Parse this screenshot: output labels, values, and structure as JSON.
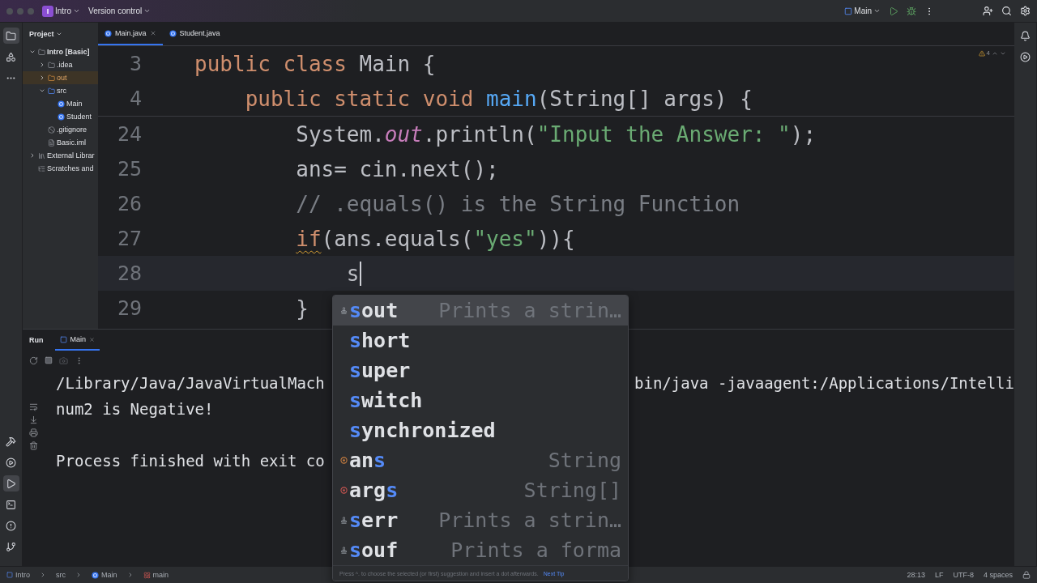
{
  "title_bar": {
    "project_badge": "I",
    "project": "Intro",
    "vcs": "Version control",
    "run_config": "Main"
  },
  "tool_windows": [
    {
      "kind": "project",
      "selected": true
    },
    {
      "kind": "structure",
      "selected": false
    },
    {
      "kind": "more",
      "selected": false
    }
  ],
  "bottom_tools": [
    {
      "kind": "build",
      "selected": false
    },
    {
      "kind": "services",
      "selected": false
    },
    {
      "kind": "run",
      "selected": true
    },
    {
      "kind": "terminal",
      "selected": false
    },
    {
      "kind": "problems",
      "selected": false
    },
    {
      "kind": "git",
      "selected": false
    }
  ],
  "project_panel": {
    "title": "Project",
    "tree": [
      {
        "label": "Intro [Basic]",
        "kind": "module",
        "expanded": true,
        "selected": false,
        "children": [
          {
            "label": ".idea",
            "kind": "folder",
            "expanded": false,
            "selected": false
          },
          {
            "label": "out",
            "kind": "excluded",
            "expanded": false,
            "selected": true
          },
          {
            "label": "src",
            "kind": "source",
            "expanded": true,
            "selected": false,
            "children": [
              {
                "label": "Main",
                "kind": "class",
                "selected": false
              },
              {
                "label": "Student",
                "kind": "class",
                "selected": false
              }
            ]
          },
          {
            "label": ".gitignore",
            "kind": "ignore",
            "selected": false
          },
          {
            "label": "Basic.iml",
            "kind": "iml",
            "selected": false
          }
        ]
      },
      {
        "label": "External Librar",
        "kind": "libraries",
        "expanded": false,
        "selected": false
      },
      {
        "label": "Scratches and",
        "kind": "scratches",
        "selected": false
      }
    ]
  },
  "editor": {
    "tabs": [
      {
        "label": "Main.java",
        "selected": true
      },
      {
        "label": "Student.java",
        "selected": false
      }
    ],
    "warning_count": "4",
    "sticky_lines": [
      {
        "number": "3",
        "tokens": [
          {
            "kind": "keyword",
            "text": "public class "
          },
          {
            "kind": "plain",
            "text": "Main {"
          }
        ]
      },
      {
        "number": "4",
        "tokens": [
          {
            "kind": "keyword",
            "text": "    public static void "
          },
          {
            "kind": "method",
            "text": "main"
          },
          {
            "kind": "plain",
            "text": "(String[] args) {"
          }
        ]
      }
    ],
    "lines": [
      {
        "number": "24",
        "current": false,
        "tokens": [
          {
            "kind": "plain",
            "text": "        System."
          },
          {
            "kind": "field",
            "text": "out"
          },
          {
            "kind": "plain",
            "text": ".println("
          },
          {
            "kind": "string",
            "text": "\"Input the Answer: \""
          },
          {
            "kind": "plain",
            "text": ");"
          }
        ]
      },
      {
        "number": "25",
        "current": false,
        "tokens": [
          {
            "kind": "plain",
            "text": "        ans= cin.next();"
          }
        ]
      },
      {
        "number": "26",
        "current": false,
        "tokens": [
          {
            "kind": "comment",
            "text": "        // .equals() is the String Function"
          }
        ]
      },
      {
        "number": "27",
        "current": false,
        "tokens": [
          {
            "kind": "warned_keyword",
            "text": "        if"
          },
          {
            "kind": "plain",
            "text": "(ans.equals("
          },
          {
            "kind": "string",
            "text": "\"yes\""
          },
          {
            "kind": "plain",
            "text": ")){"
          }
        ]
      },
      {
        "number": "28",
        "current": true,
        "tokens": [
          {
            "kind": "plain",
            "text": "            s"
          }
        ]
      },
      {
        "number": "29",
        "current": false,
        "tokens": [
          {
            "kind": "plain",
            "text": "        }"
          }
        ]
      }
    ]
  },
  "completion": {
    "items": [
      {
        "kind": "template",
        "match": "s",
        "tail": "out",
        "detail": "Prints a strin…",
        "selected": true
      },
      {
        "kind": "keyword",
        "match": "s",
        "tail": "hort",
        "selected": false
      },
      {
        "kind": "keyword",
        "match": "s",
        "tail": "uper",
        "selected": false
      },
      {
        "kind": "keyword",
        "match": "s",
        "tail": "witch",
        "selected": false
      },
      {
        "kind": "keyword",
        "match": "s",
        "tail": "ynchronized",
        "selected": false
      },
      {
        "kind": "variable",
        "head": "an",
        "match": "s",
        "type": "String",
        "selected": false
      },
      {
        "kind": "parameter",
        "head": "arg",
        "match": "s",
        "type": "String[]",
        "selected": false
      },
      {
        "kind": "template",
        "match": "s",
        "tail": "err",
        "detail": "Prints a strin…",
        "selected": false
      },
      {
        "kind": "template",
        "match": "s",
        "tail": "ouf",
        "detail": "Prints a forma",
        "selected": false
      }
    ],
    "hint": "Press ^. to choose the selected (or first) suggestion and insert a dot afterwards.",
    "next_tip": "Next Tip"
  },
  "run_panel": {
    "title": "Run",
    "tabs": [
      {
        "label": "Main",
        "selected": true
      }
    ],
    "output": [
      {
        "parts": [
          "/Library/Java/JavaVirtualMach",
          "bin/java -javaagent:/Applications/Intelli"
        ],
        "blank_before": false
      },
      {
        "parts": [
          "num2 is Negative!"
        ],
        "blank_before": false
      },
      {
        "parts": [
          "Process finished with exit co"
        ],
        "blank_before": true
      }
    ]
  },
  "breadcrumbs": [
    {
      "label": "Intro",
      "kind": "module"
    },
    {
      "label": "src",
      "kind": "folder"
    },
    {
      "label": "Main",
      "kind": "class"
    },
    {
      "label": "main",
      "kind": "method"
    }
  ],
  "status": [
    "28:13",
    "LF",
    "UTF-8",
    "4 spaces"
  ]
}
